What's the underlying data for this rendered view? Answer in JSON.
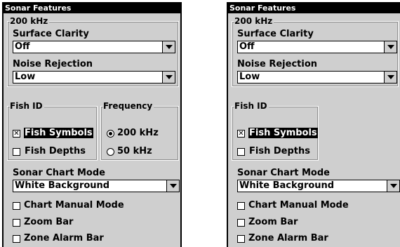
{
  "screens": [
    {
      "title": "Sonar Features",
      "group_200khz": {
        "legend": "200 kHz",
        "surface_clarity_label": "Surface Clarity",
        "surface_clarity_value": "Off",
        "noise_rejection_label": "Noise Rejection",
        "noise_rejection_value": "Low"
      },
      "fish_id": {
        "legend": "Fish ID",
        "fish_symbols_label": "Fish Symbols",
        "fish_symbols_checked": true,
        "fish_depths_label": "Fish Depths",
        "fish_depths_checked": false
      },
      "frequency": {
        "legend": "Frequency",
        "option_200": "200 kHz",
        "option_50": "50 kHz",
        "selected": "200 kHz"
      },
      "sonar_chart_mode_label": "Sonar Chart Mode",
      "sonar_chart_mode_value": "White Background",
      "chart_manual_mode_label": "Chart Manual Mode",
      "zoom_bar_label": "Zoom Bar",
      "zone_alarm_bar_label": "Zone Alarm Bar"
    },
    {
      "title": "Sonar Features",
      "group_200khz": {
        "legend": "200 kHz",
        "surface_clarity_label": "Surface Clarity",
        "surface_clarity_value": "Off",
        "noise_rejection_label": "Noise Rejection",
        "noise_rejection_value": "Low"
      },
      "fish_id": {
        "legend": "Fish ID",
        "fish_symbols_label": "Fish Symbols",
        "fish_symbols_checked": true,
        "fish_depths_label": "Fish Depths",
        "fish_depths_checked": false
      },
      "sonar_chart_mode_label": "Sonar Chart Mode",
      "sonar_chart_mode_value": "White Background",
      "chart_manual_mode_label": "Chart Manual Mode",
      "zoom_bar_label": "Zoom Bar",
      "zone_alarm_bar_label": "Zone Alarm Bar"
    }
  ],
  "check_mark": "✕"
}
